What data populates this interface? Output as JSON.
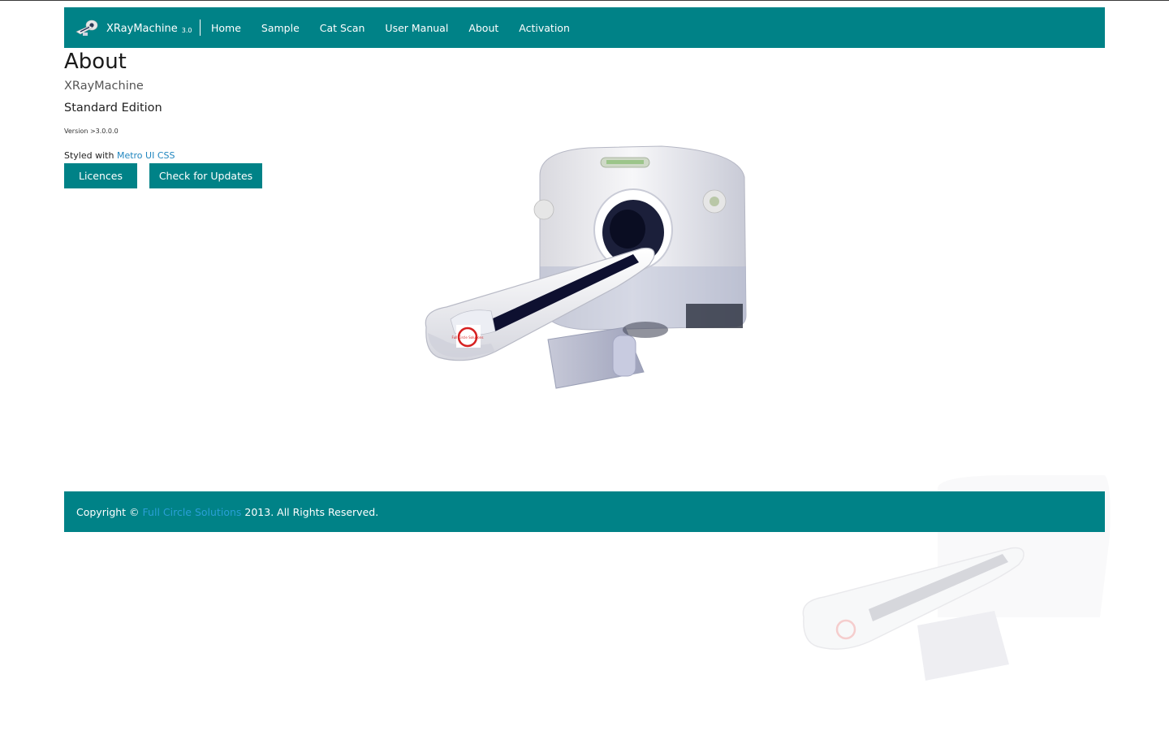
{
  "navbar": {
    "brand_name": "XRayMachine",
    "brand_version": "3.0",
    "items": [
      {
        "label": "Home"
      },
      {
        "label": "Sample"
      },
      {
        "label": "Cat Scan"
      },
      {
        "label": "User Manual"
      },
      {
        "label": "About"
      },
      {
        "label": "Activation"
      }
    ]
  },
  "main": {
    "title": "About",
    "product": "XRayMachine",
    "edition": "Standard Edition",
    "version": "Version >3.0.0.0",
    "styled_prefix": "Styled with",
    "styled_link": "Metro UI CSS",
    "buttons": {
      "licences": "Licences",
      "updates": "Check for Updates"
    },
    "device_logo_text": "Full Circle Solutions"
  },
  "footer": {
    "prefix": "Copyright ©",
    "link": "Full Circle Solutions",
    "suffix": "2013. All Rights Reserved."
  },
  "colors": {
    "accent": "#008287",
    "link": "#2086bf"
  },
  "icons": {
    "brand": "xray-scanner-icon"
  }
}
